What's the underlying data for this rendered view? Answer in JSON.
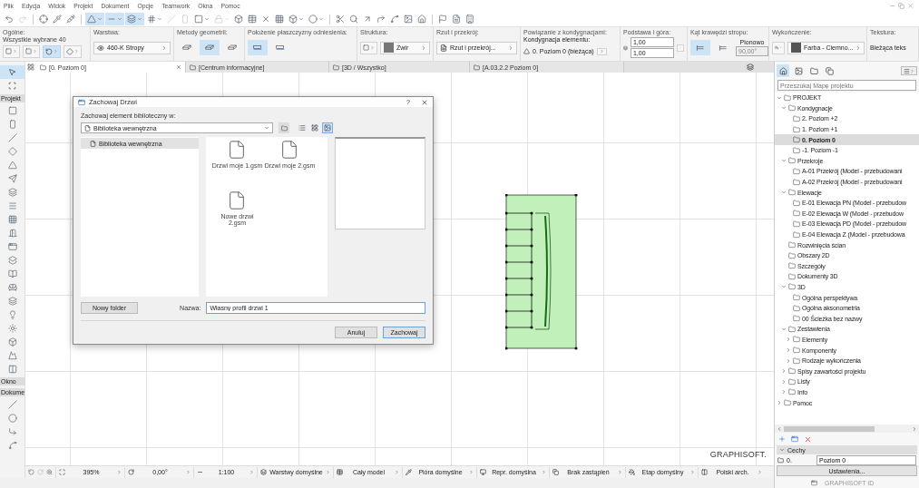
{
  "menu": [
    "Plik",
    "Edycja",
    "Widok",
    "Projekt",
    "Dokument",
    "Opcje",
    "Teamwork",
    "Okna",
    "Pomoc"
  ],
  "toolbar": [
    {
      "selected": false,
      "caret": false,
      "disabled": false
    },
    {
      "selected": false,
      "caret": false,
      "disabled": true
    },
    {
      "selected": false,
      "caret": false,
      "disabled": false
    },
    {
      "selected": false,
      "caret": false,
      "disabled": false
    },
    {
      "selected": false,
      "caret": false,
      "disabled": false
    },
    {
      "selected": true,
      "caret": true,
      "disabled": false
    },
    {
      "selected": true,
      "caret": true,
      "disabled": false
    },
    {
      "selected": true,
      "caret": true,
      "disabled": false
    },
    {
      "selected": false,
      "caret": true,
      "disabled": false
    },
    {
      "selected": false,
      "caret": false,
      "disabled": true
    },
    {
      "selected": false,
      "caret": false,
      "disabled": true
    },
    {
      "selected": false,
      "caret": true,
      "disabled": false
    },
    {
      "selected": false,
      "caret": true,
      "disabled": true
    },
    {
      "selected": false,
      "caret": false,
      "disabled": false
    },
    {
      "selected": false,
      "caret": false,
      "disabled": false
    },
    {
      "selected": false,
      "caret": false,
      "disabled": false
    },
    {
      "selected": false,
      "caret": false,
      "disabled": false
    },
    {
      "selected": false,
      "caret": true,
      "disabled": false
    },
    {
      "selected": false,
      "caret": true,
      "disabled": false
    },
    {
      "selected": false,
      "caret": false,
      "disabled": false
    },
    {
      "selected": false,
      "caret": false,
      "disabled": false
    },
    {
      "selected": false,
      "caret": false,
      "disabled": false
    },
    {
      "selected": false,
      "caret": false,
      "disabled": false
    },
    {
      "selected": false,
      "caret": false,
      "disabled": false
    },
    {
      "selected": false,
      "caret": false,
      "disabled": false
    },
    {
      "selected": false,
      "caret": false,
      "disabled": false
    },
    {
      "selected": false,
      "caret": false,
      "disabled": false
    },
    {
      "selected": false,
      "caret": false,
      "disabled": false
    },
    {
      "selected": false,
      "caret": false,
      "disabled": false
    }
  ],
  "info_box": [
    {
      "kind": "selection",
      "label": "Ogólne:",
      "text": "Wszystkie wybrane 40",
      "options": [
        {
          "selected": false
        },
        {
          "selected": false
        },
        {
          "selected": true
        },
        {
          "selected": false
        }
      ]
    },
    {
      "kind": "layer",
      "label": "Warstwa:",
      "value": "460-K Stropy"
    },
    {
      "kind": "options",
      "label": "Metody geometrii:",
      "options": [
        {
          "selected": false
        },
        {
          "selected": true
        },
        {
          "selected": false
        }
      ]
    },
    {
      "kind": "options",
      "label": "Położenie płaszczyzny odniesienia:",
      "options": [
        {
          "selected": true
        },
        {
          "selected": false
        }
      ]
    },
    {
      "kind": "structure",
      "label": "Struktura:",
      "value": "Żwir"
    },
    {
      "kind": "view",
      "label": "Rzut i przekrój:",
      "value": "Rzut i przekrój..."
    },
    {
      "kind": "story",
      "label": "Powiązanie z kondygnacjami:",
      "title": "Kondygnacja elementu:",
      "value": "0. Poziom 0 (bieżąca)"
    },
    {
      "kind": "heights",
      "label": "Podstawa i góra:",
      "values": [
        "1,00",
        "1,00"
      ]
    },
    {
      "kind": "angle",
      "label": "Kąt krawędzi stropu:",
      "options": [
        {
          "selected": true
        },
        {
          "selected": false
        }
      ],
      "text": "Pionowo",
      "value": "90,00°"
    },
    {
      "kind": "surface",
      "label": "Wykończenie:",
      "value": "Farba - Ciemno..."
    },
    {
      "kind": "text",
      "label": "Tekstura:",
      "value": "Bieżąca teks"
    }
  ],
  "toolbox": {
    "top_tools": [
      {
        "selected": true
      },
      {
        "selected": false
      }
    ],
    "sections": [
      "Projekt",
      "Okno",
      "Dokume"
    ]
  },
  "tabs": [
    {
      "label": "[0. Poziom 0]",
      "selected": true
    },
    {
      "label": "[Centrum informacyjne]",
      "selected": false
    },
    {
      "label": "[3D / Wszystko]",
      "selected": false
    },
    {
      "label": "[A.03.2.2 Poziom 0]",
      "selected": false
    }
  ],
  "canvas": {
    "logo": "GRAPHISOFT."
  },
  "dialog": {
    "title": "Zachowaj Drzwi",
    "help": "?",
    "location_label": "Zachowaj element biblioteczny w:",
    "location": "Biblioteka wewnętrzna",
    "view_modes": [
      {
        "selected": false
      },
      {
        "selected": false
      },
      {
        "selected": true
      }
    ],
    "folders": [
      {
        "label": "Biblioteka wewnętrzna",
        "selected": true
      }
    ],
    "files": [
      "Drzwi moje 1.gsm",
      "Drzwi moje 2.gsm",
      "Nowe drzwi 2.gsm"
    ],
    "new_folder": "Nowy folder",
    "name_label": "Nazwa:",
    "name_value": "Własny profil drzwi 1",
    "cancel": "Anuluj",
    "save": "Zachowaj"
  },
  "status_bar": [
    "395%",
    "0,00°",
    "1:100",
    "Warstwy domyślne",
    "Cały model",
    "Pióra domyślne",
    "Repr. domyślna",
    "Brak zastąpień",
    "Etap domyślny",
    "Polski arch."
  ],
  "navigator": {
    "view_buttons": [
      {
        "selected": true
      },
      {
        "selected": false
      },
      {
        "selected": false
      },
      {
        "selected": false
      }
    ],
    "search_placeholder": "Przeszukaj Mapę projektu",
    "tree": [
      {
        "label": "PROJEKT",
        "expanded": true,
        "selected": false,
        "children": [
          {
            "label": "Kondygnacje",
            "expanded": true,
            "selected": false,
            "children": [
              {
                "label": "2. Poziom +2",
                "selected": false
              },
              {
                "label": "1. Poziom +1",
                "selected": false
              },
              {
                "label": "0. Poziom 0",
                "selected": true
              },
              {
                "label": "-1. Poziom -1",
                "selected": false
              }
            ]
          },
          {
            "label": "Przekroje",
            "expanded": true,
            "selected": false,
            "children": [
              {
                "label": "A-01 Przekrój (Model - przebudowani",
                "selected": false
              },
              {
                "label": "A-02 Przekrój (Model - przebudowani",
                "selected": false
              }
            ]
          },
          {
            "label": "Elewacje",
            "expanded": true,
            "selected": false,
            "children": [
              {
                "label": "E-01 Elewacja PN (Model - przebudow",
                "selected": false
              },
              {
                "label": "E-02 Elewacja W (Model - przebudow",
                "selected": false
              },
              {
                "label": "E-03 Elewacja PD (Model - przebudow",
                "selected": false
              },
              {
                "label": "E-04 Elewacja Z (Model - przebudowa",
                "selected": false
              }
            ]
          },
          {
            "label": "Rozwinięcia ścian",
            "selected": false
          },
          {
            "label": "Obszary 2D",
            "selected": false
          },
          {
            "label": "Szczegóły",
            "selected": false
          },
          {
            "label": "Dokumenty 3D",
            "selected": false
          },
          {
            "label": "3D",
            "expanded": true,
            "selected": false,
            "children": [
              {
                "label": "Ogólna perspektywa",
                "selected": false
              },
              {
                "label": "Ogólna aksonometria",
                "selected": false
              },
              {
                "label": "00 Ścieżka bez nazwy",
                "selected": false
              }
            ]
          },
          {
            "label": "Zestawienia",
            "expanded": true,
            "selected": false,
            "children": [
              {
                "label": "Elementy",
                "expanded": false,
                "selected": false
              },
              {
                "label": "Komponenty",
                "expanded": false,
                "selected": false
              },
              {
                "label": "Rodzaje wykończenia",
                "expanded": false,
                "selected": false
              }
            ]
          },
          {
            "label": "Spisy zawartości projektu",
            "expanded": false,
            "selected": false
          },
          {
            "label": "Listy",
            "expanded": false,
            "selected": false
          },
          {
            "label": "Info",
            "expanded": false,
            "selected": false
          }
        ]
      },
      {
        "label": "Pomoc",
        "expanded": false,
        "selected": false
      }
    ],
    "properties": {
      "title": "Cechy",
      "expanded": true,
      "id": "0.",
      "name": "Poziom 0",
      "settings": "Ustawienia..."
    },
    "account": "GRAPHISOFT ID"
  }
}
